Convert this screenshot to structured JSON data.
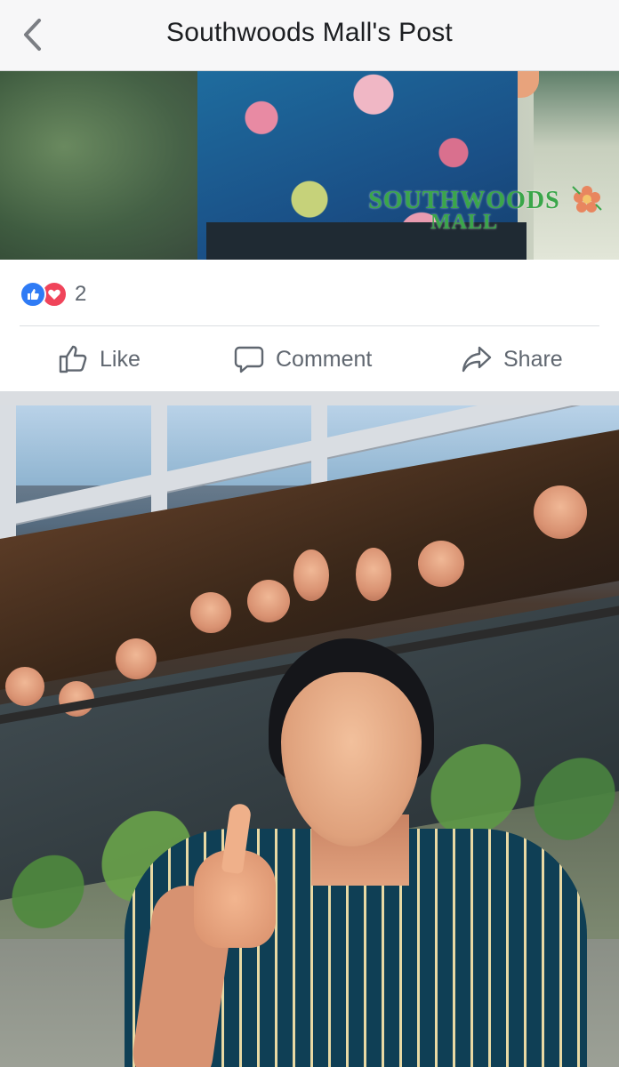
{
  "header": {
    "title": "Southwoods Mall's Post",
    "back_icon": "chevron-left-icon"
  },
  "post": {
    "watermark": {
      "line1": "SOUTHWOODS",
      "line2": "MALL"
    },
    "reactions": {
      "types": [
        "like",
        "love"
      ],
      "count": "2"
    },
    "actions": {
      "like": "Like",
      "comment": "Comment",
      "share": "Share"
    }
  },
  "colors": {
    "like_blue": "#2f7bf5",
    "love_red": "#f0445a",
    "action_gray": "#606770",
    "header_bg": "#f7f7f8",
    "separator": "#dadde1"
  }
}
